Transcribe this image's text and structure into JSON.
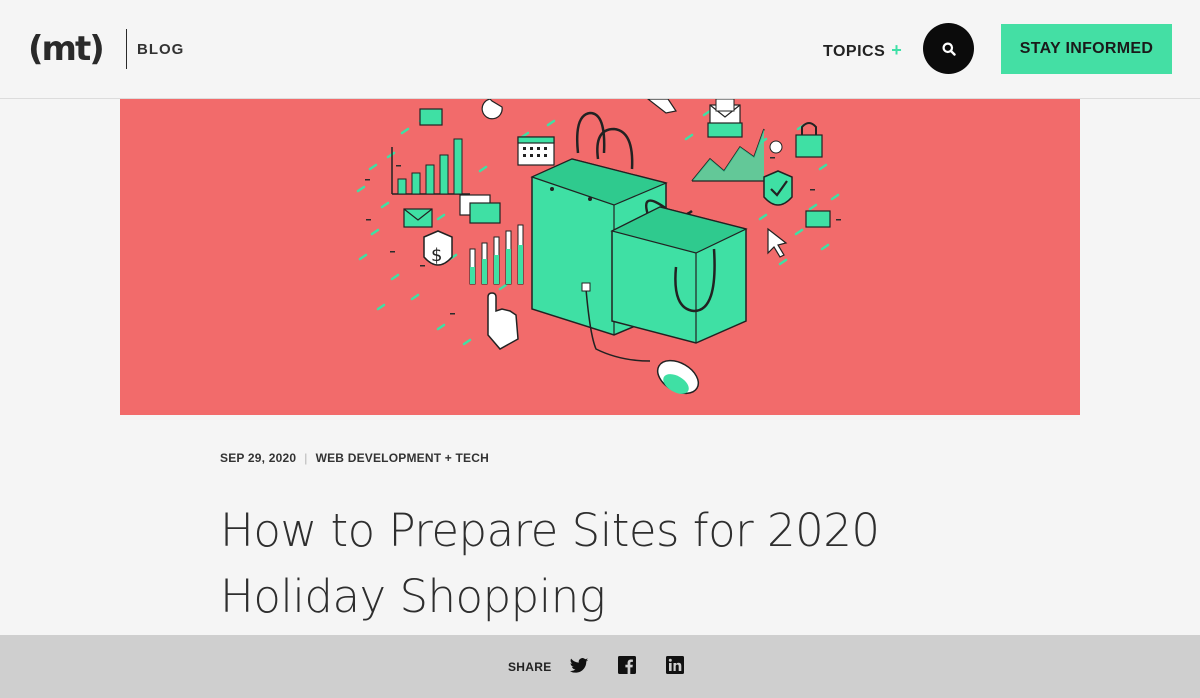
{
  "header": {
    "logo_text": "(mt)",
    "blog_label": "BLOG",
    "topics_label": "TOPICS",
    "topics_plus": "+",
    "search_icon": "search-icon",
    "cta_label": "STAY INFORMED"
  },
  "colors": {
    "accent_green": "#44dfa4",
    "hero_background": "#f26b6b",
    "share_bar": "#cfcfcf"
  },
  "article": {
    "date": "SEP 29, 2020",
    "separator": "|",
    "category": "WEB DEVELOPMENT + TECH",
    "title_line1": "How to Prepare Sites for 2020",
    "title_line2": "Holiday Shopping"
  },
  "share": {
    "label": "SHARE",
    "icons": [
      "twitter-icon",
      "facebook-icon",
      "linkedin-icon"
    ]
  }
}
